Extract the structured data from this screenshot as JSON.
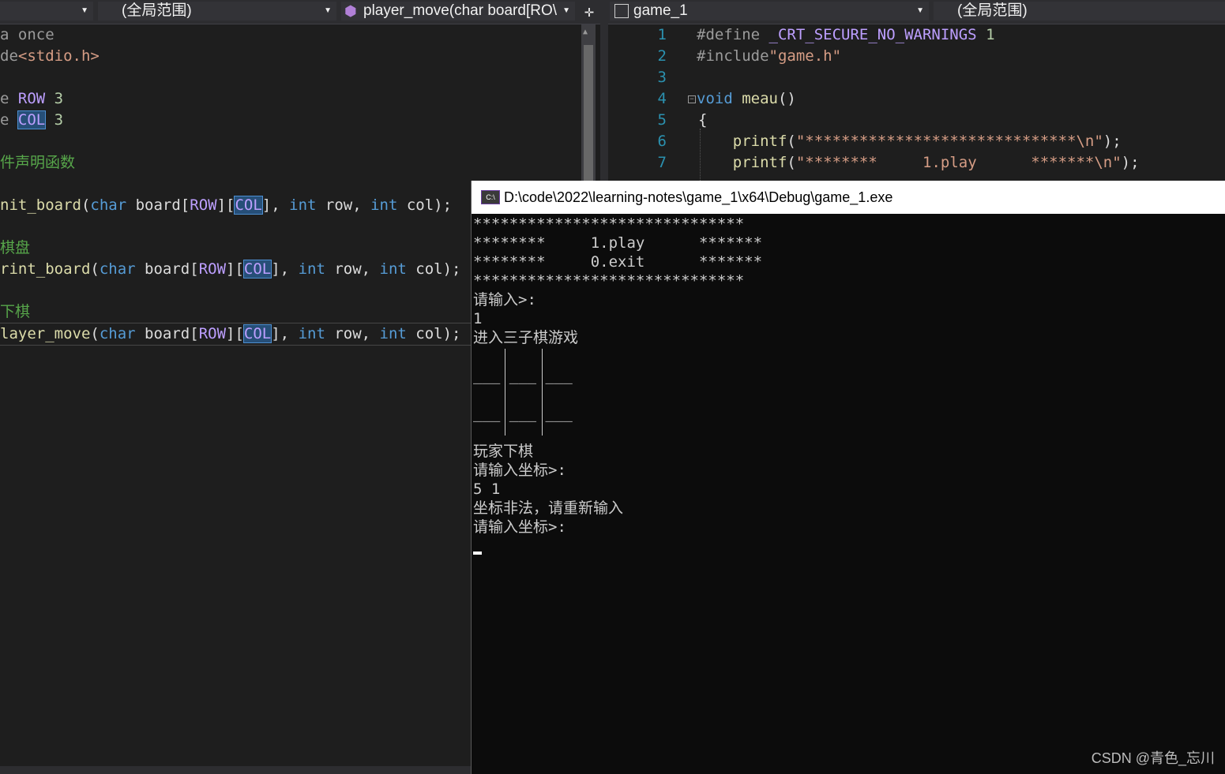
{
  "left_nav": {
    "scope": "(全局范围)",
    "function": "player_move(char board[RO\\"
  },
  "right_nav": {
    "file": "game_1",
    "scope": "(全局范围)"
  },
  "left_code": [
    "a once",
    "de<stdio.h>",
    "e ROW 3",
    "e COL 3",
    "件声明函数",
    "nit_board(char board[ROW][COL], int row, int col);",
    "棋盘",
    "rint_board(char board[ROW][COL], int row, int col);",
    "下棋",
    "layer_move(char board[ROW][COL], int row, int col);"
  ],
  "right_code": {
    "line_numbers": [
      "1",
      "2",
      "3",
      "4",
      "5",
      "6",
      "7"
    ],
    "lines": [
      "#define _CRT_SECURE_NO_WARNINGS 1",
      "#include\"game.h\"",
      "",
      "void meau()",
      "{",
      "    printf(\"******************************\\n\");",
      "    printf(\"********     1.play      *******\\n\");"
    ]
  },
  "console": {
    "title": "D:\\code\\2022\\learning-notes\\game_1\\x64\\Debug\\game_1.exe",
    "lines": [
      "******************************",
      "********     1.play      *******",
      "********     0.exit      *******",
      "******************************",
      "请输入>:",
      "1",
      "进入三子棋游戏",
      "",
      "___ ___ ___",
      "",
      "",
      "___ ___ ___",
      "",
      "",
      "玩家下棋",
      "请输入坐标>:",
      "5 1",
      "坐标非法，请重新输入",
      "请输入坐标>:"
    ]
  },
  "watermark": "CSDN @青色_忘川"
}
